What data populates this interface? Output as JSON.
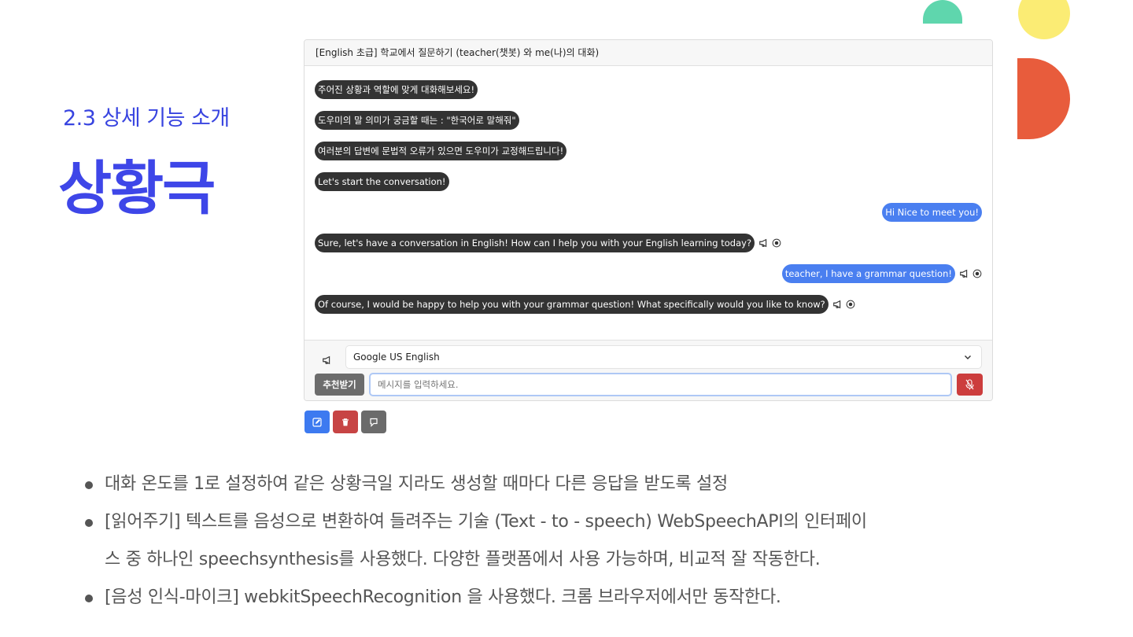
{
  "section": {
    "subtitle": "2.3 상세 기능 소개",
    "title": "상황극"
  },
  "chat": {
    "header": "[English 초급] 학교에서 질문하기 (teacher(챗봇) 와 me(나)의 대화)",
    "messages": [
      {
        "role": "bot",
        "text": "주어진 상황과 역할에 맞게 대화해보세요!"
      },
      {
        "role": "bot",
        "text": "도우미의 말 의미가 궁금할 때는 : \"한국어로 말해줘\""
      },
      {
        "role": "bot",
        "text": "여러분의 답변에 문법적 오류가 있으면 도우미가 교정해드립니다!"
      },
      {
        "role": "bot",
        "text": "Let's start the conversation!"
      },
      {
        "role": "user",
        "text": "Hi Nice to meet you!"
      },
      {
        "role": "bot",
        "text": "Sure, let's have a conversation in English! How can I help you with your English learning today?"
      },
      {
        "role": "user",
        "text": "teacher, I have a grammar question!"
      },
      {
        "role": "bot",
        "text": "Of course, I would be happy to help you with your grammar question! What specifically would you like to know?"
      }
    ],
    "voice_select": "Google US English",
    "recommend_button": "추천받기",
    "input_placeholder": "메시지를 입력하세요."
  },
  "icons": {
    "speaker": "megaphone-icon",
    "record": "record-circle-icon",
    "mic_off": "mic-off-icon",
    "edit": "edit-icon",
    "delete": "trash-icon",
    "other": "comment-icon"
  },
  "colors": {
    "accent": "#3e46e8",
    "bot_bubble": "#333333",
    "user_bubble": "#4a7ff0",
    "mic_button": "#cc3d3d"
  },
  "bullets": [
    {
      "text": "대화 온도를 1로 설정하여 같은 상황극일 지라도 생성할 때마다 다른 응답을 받도록 설정"
    },
    {
      "text": "[읽어주기] 텍스트를 음성으로 변환하여 들려주는 기술 (Text - to - speech) WebSpeechAPI의 인터페이",
      "text2": "스 중 하나인 speechsynthesis를 사용했다. 다양한 플랫폼에서 사용 가능하며, 비교적 잘 작동한다."
    },
    {
      "text": "[음성 인식-마이크] webkitSpeechRecognition 을 사용했다. 크롬 브라우저에서만 동작한다."
    }
  ]
}
